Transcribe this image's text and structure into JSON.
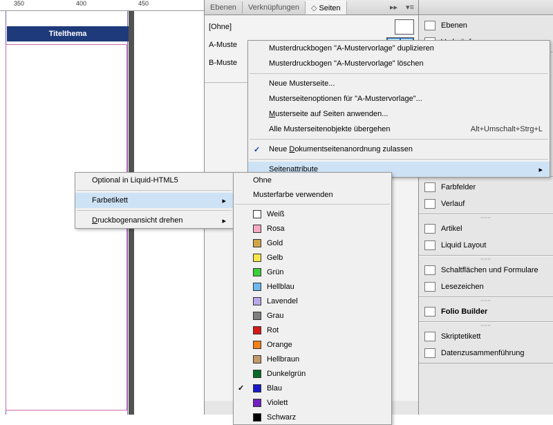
{
  "ruler": {
    "t350": "350",
    "t400": "400",
    "t450": "450"
  },
  "doc": {
    "title": "Titelthema"
  },
  "tabs": {
    "ebenen": "Ebenen",
    "verk": "Verknüpfungen",
    "seiten": "Seiten",
    "dbl": "▸▸"
  },
  "masters": {
    "none": "[Ohne]",
    "a": "A-Muste",
    "b": "B-Muste"
  },
  "ctx": {
    "dup": "Musterdruckbogen \"A-Mustervorlage\" duplizieren",
    "del": "Musterdruckbogen \"A-Mustervorlage\" löschen",
    "neu": "Neue Musterseite...",
    "opt": "Musterseitenoptionen für \"A-Mustervorlage\"...",
    "anw_pre": "",
    "anw": "Musterseite auf Seiten anwenden...",
    "ueb": "Alle Musterseitenobjekte übergehen",
    "ueb_sc": "Alt+Umschalt+Strg+L",
    "reorder": "Neue Dokumentseitenanordnung zulassen",
    "seiten": "Seitenattribute"
  },
  "sub1": {
    "liquid": "Optional in Liquid-HTML5",
    "farbe": "Farbetikett",
    "drehen": "Druckbogenansicht drehen"
  },
  "sub2": {
    "ohne": "Ohne",
    "master": "Musterfarbe verwenden"
  },
  "colors": [
    {
      "n": "Weiß",
      "c": "#ffffff"
    },
    {
      "n": "Rosa",
      "c": "#f7a8c4"
    },
    {
      "n": "Gold",
      "c": "#d0a54a"
    },
    {
      "n": "Gelb",
      "c": "#f6e64a"
    },
    {
      "n": "Grün",
      "c": "#3bcf3b"
    },
    {
      "n": "Hellblau",
      "c": "#6fb8f0"
    },
    {
      "n": "Lavendel",
      "c": "#b8a8e8"
    },
    {
      "n": "Grau",
      "c": "#808080"
    },
    {
      "n": "Rot",
      "c": "#d31818"
    },
    {
      "n": "Orange",
      "c": "#f08018"
    },
    {
      "n": "Hellbraun",
      "c": "#c29a6a"
    },
    {
      "n": "Dunkelgrün",
      "c": "#0a6a25"
    },
    {
      "n": "Blau",
      "c": "#1818c8",
      "chk": true
    },
    {
      "n": "Violett",
      "c": "#7020c0"
    },
    {
      "n": "Schwarz",
      "c": "#000000"
    }
  ],
  "right": {
    "ebenen": "Ebenen",
    "verk": "Verknüpfungen",
    "farbf": "Farbfelder",
    "verlauf": "Verlauf",
    "artikel": "Artikel",
    "liquid": "Liquid Layout",
    "schalt": "Schaltflächen und Formulare",
    "lese": "Lesezeichen",
    "folio": "Folio Builder",
    "skript": "Skriptetikett",
    "daten": "Datenzusammenführung"
  },
  "u": {
    "m": "M",
    "d": "D",
    "s": "S",
    "a": "A"
  }
}
